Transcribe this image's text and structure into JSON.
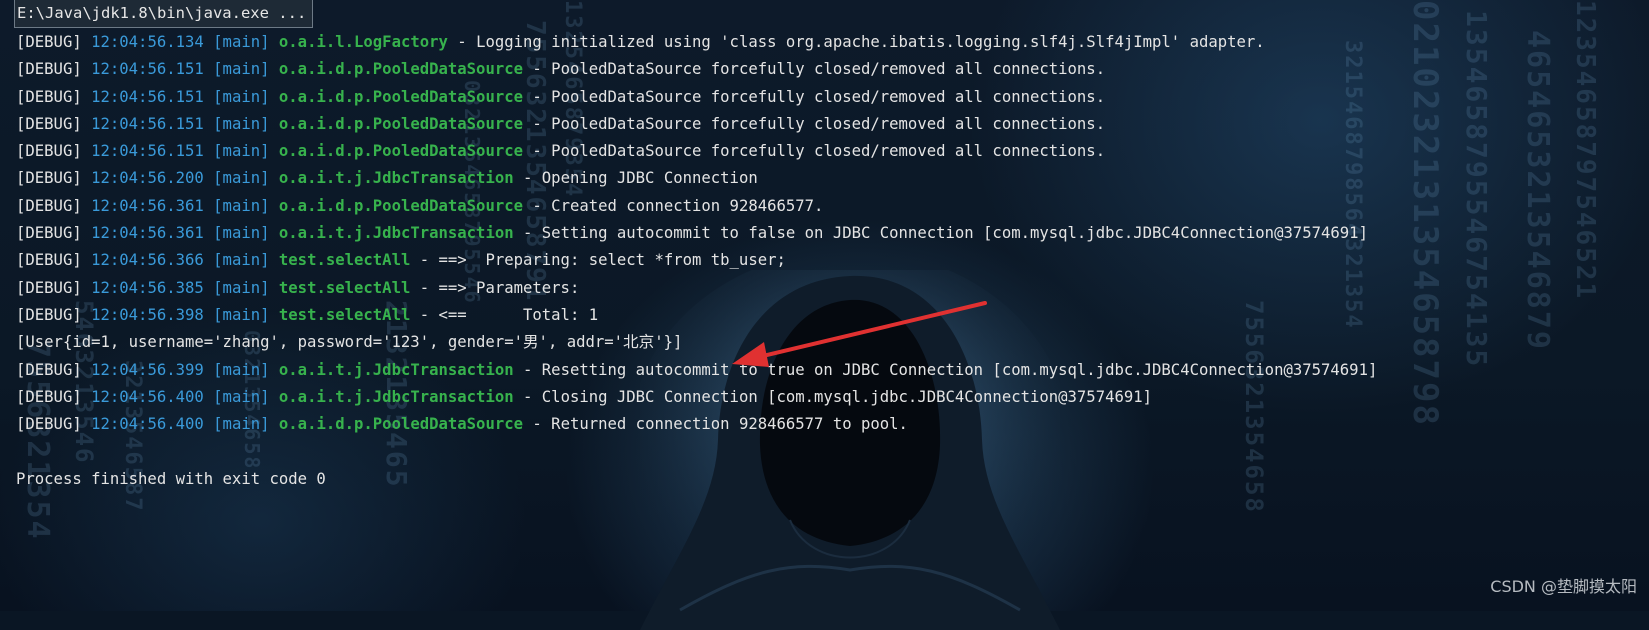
{
  "console": {
    "title": "E:\\Java\\jdk1.8\\bin\\java.exe ...",
    "log_lines": [
      {
        "level": "[DEBUG]",
        "time": "12:04:56.134",
        "thread": "[main]",
        "logger": "o.a.i.l.LogFactory",
        "message": " - Logging initialized using 'class org.apache.ibatis.logging.slf4j.Slf4jImpl' adapter."
      },
      {
        "level": "[DEBUG]",
        "time": "12:04:56.151",
        "thread": "[main]",
        "logger": "o.a.i.d.p.PooledDataSource",
        "message": " - PooledDataSource forcefully closed/removed all connections."
      },
      {
        "level": "[DEBUG]",
        "time": "12:04:56.151",
        "thread": "[main]",
        "logger": "o.a.i.d.p.PooledDataSource",
        "message": " - PooledDataSource forcefully closed/removed all connections."
      },
      {
        "level": "[DEBUG]",
        "time": "12:04:56.151",
        "thread": "[main]",
        "logger": "o.a.i.d.p.PooledDataSource",
        "message": " - PooledDataSource forcefully closed/removed all connections."
      },
      {
        "level": "[DEBUG]",
        "time": "12:04:56.151",
        "thread": "[main]",
        "logger": "o.a.i.d.p.PooledDataSource",
        "message": " - PooledDataSource forcefully closed/removed all connections."
      },
      {
        "level": "[DEBUG]",
        "time": "12:04:56.200",
        "thread": "[main]",
        "logger": "o.a.i.t.j.JdbcTransaction",
        "message": " - Opening JDBC Connection"
      },
      {
        "level": "[DEBUG]",
        "time": "12:04:56.361",
        "thread": "[main]",
        "logger": "o.a.i.d.p.PooledDataSource",
        "message": " - Created connection 928466577."
      },
      {
        "level": "[DEBUG]",
        "time": "12:04:56.361",
        "thread": "[main]",
        "logger": "o.a.i.t.j.JdbcTransaction",
        "message": " - Setting autocommit to false on JDBC Connection [com.mysql.jdbc.JDBC4Connection@37574691]"
      },
      {
        "level": "[DEBUG]",
        "time": "12:04:56.366",
        "thread": "[main]",
        "logger": "test.selectAll",
        "message": " - ==>  Preparing: select *from tb_user;"
      },
      {
        "level": "[DEBUG]",
        "time": "12:04:56.385",
        "thread": "[main]",
        "logger": "test.selectAll",
        "message": " - ==> Parameters: "
      },
      {
        "level": "[DEBUG]",
        "time": "12:04:56.398",
        "thread": "[main]",
        "logger": "test.selectAll",
        "message": " - <==      Total: 1"
      }
    ],
    "result_line": "[User{id=1, username='zhang', password='123', gender='男', addr='北京'}]",
    "log_lines_after": [
      {
        "level": "[DEBUG]",
        "time": "12:04:56.399",
        "thread": "[main]",
        "logger": "o.a.i.t.j.JdbcTransaction",
        "message": " - Resetting autocommit to true on JDBC Connection [com.mysql.jdbc.JDBC4Connection@37574691]"
      },
      {
        "level": "[DEBUG]",
        "time": "12:04:56.400",
        "thread": "[main]",
        "logger": "o.a.i.t.j.JdbcTransaction",
        "message": " - Closing JDBC Connection [com.mysql.jdbc.JDBC4Connection@37574691]"
      },
      {
        "level": "[DEBUG]",
        "time": "12:04:56.400",
        "thread": "[main]",
        "logger": "o.a.i.d.p.PooledDataSource",
        "message": " - Returned connection 928466577 to pool."
      }
    ],
    "exit_line": "Process finished with exit code 0"
  },
  "watermark": "CSDN @垫脚摸太阳",
  "colors": {
    "timestamp": "#3a9ad9",
    "logger": "#37b24d",
    "text": "#e4e4e4",
    "arrow": "#e03131",
    "background": "#0a1624"
  },
  "icons": {
    "annotation": "red-arrow"
  }
}
